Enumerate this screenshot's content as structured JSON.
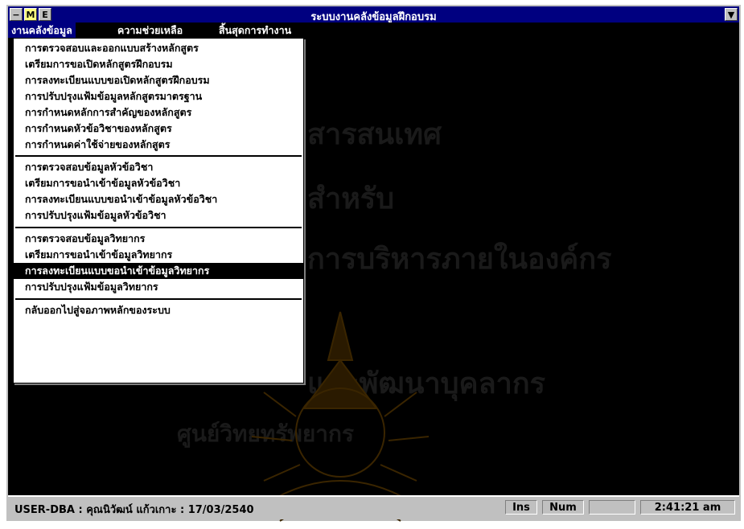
{
  "window": {
    "title": "ระบบงานคลังข้อมูลฝึกอบรม",
    "control_icon": "−",
    "btn_m": "M",
    "btn_e": "E",
    "scroll_icon": "▼"
  },
  "menubar": {
    "items": [
      {
        "label": "งานคลังข้อมูล",
        "active": true
      },
      {
        "label": "ความช่วยเหลือ",
        "active": false
      },
      {
        "label": "สิ้นสุดการทำงาน",
        "active": false
      }
    ]
  },
  "dropdown": {
    "groups": [
      [
        "การตรวจสอบและออกแบบสร้างหลักสูตร",
        "เตรียมการขอเปิดหลักสูตรฝึกอบรม",
        "การลงทะเบียนแบบขอเปิดหลักสูตรฝึกอบรม",
        "การปรับปรุงแฟ้มข้อมูลหลักสูตรมาตรฐาน",
        "การกำหนดหลักการสำคัญของหลักสูตร",
        "การกำหนดหัวข้อวิชาของหลักสูตร",
        "การกำหนดค่าใช้จ่ายของหลักสูตร"
      ],
      [
        "การตรวจสอบข้อมูลหัวข้อวิชา",
        "เตรียมการขอนำเข้าข้อมูลหัวข้อวิชา",
        "การลงทะเบียนแบบขอนำเข้าข้อมูลหัวข้อวิชา",
        "การปรับปรุงแฟ้มข้อมูลหัวข้อวิชา"
      ],
      [
        "การตรวจสอบข้อมูลวิทยากร",
        "เตรียมการขอนำเข้าข้อมูลวิทยากร",
        "การลงทะเบียนแบบขอนำเข้าข้อมูลวิทยากร",
        "การปรับปรุงแฟ้มข้อมูลวิทยากร"
      ],
      [
        "กลับออกไปสู่จอภาพหลักของระบบ"
      ]
    ],
    "selected": "การลงทะเบียนแบบขอนำเข้าข้อมูลวิทยากร"
  },
  "statusbar": {
    "user": "USER-DBA  :  คุณนิวัฒน์  แก้วเกาะ  :  17/03/2540",
    "ins": "Ins",
    "num": "Num",
    "blank": "",
    "time": "2:41:21 am"
  }
}
